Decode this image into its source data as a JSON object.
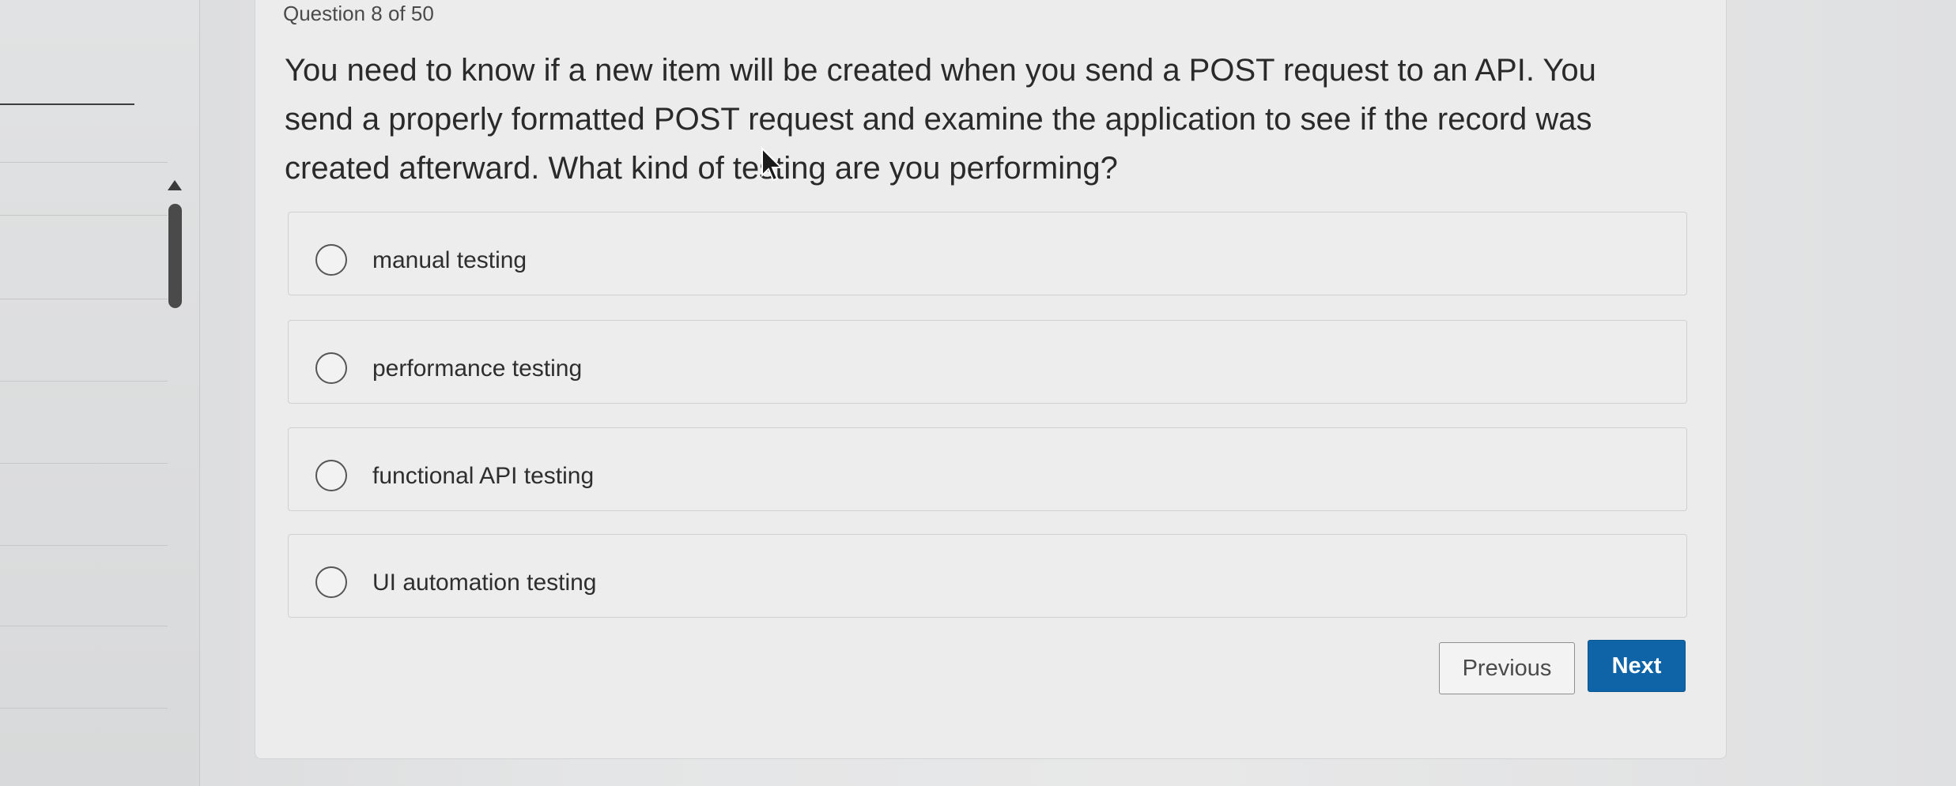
{
  "question": {
    "counter": "Question 8 of 50",
    "text": "You need to know if a new item will be created when you send a POST request to an API. You send a properly formatted POST request and examine the application to see if the record was created afterward. What kind of testing are you performing?"
  },
  "options": [
    {
      "label": "manual testing"
    },
    {
      "label": "performance testing"
    },
    {
      "label": "functional API testing"
    },
    {
      "label": "UI automation testing"
    }
  ],
  "navigation": {
    "previous_label": "Previous",
    "next_label": "Next"
  },
  "colors": {
    "next_button": "#0f64a8",
    "page_background": "#e4e5e6"
  }
}
